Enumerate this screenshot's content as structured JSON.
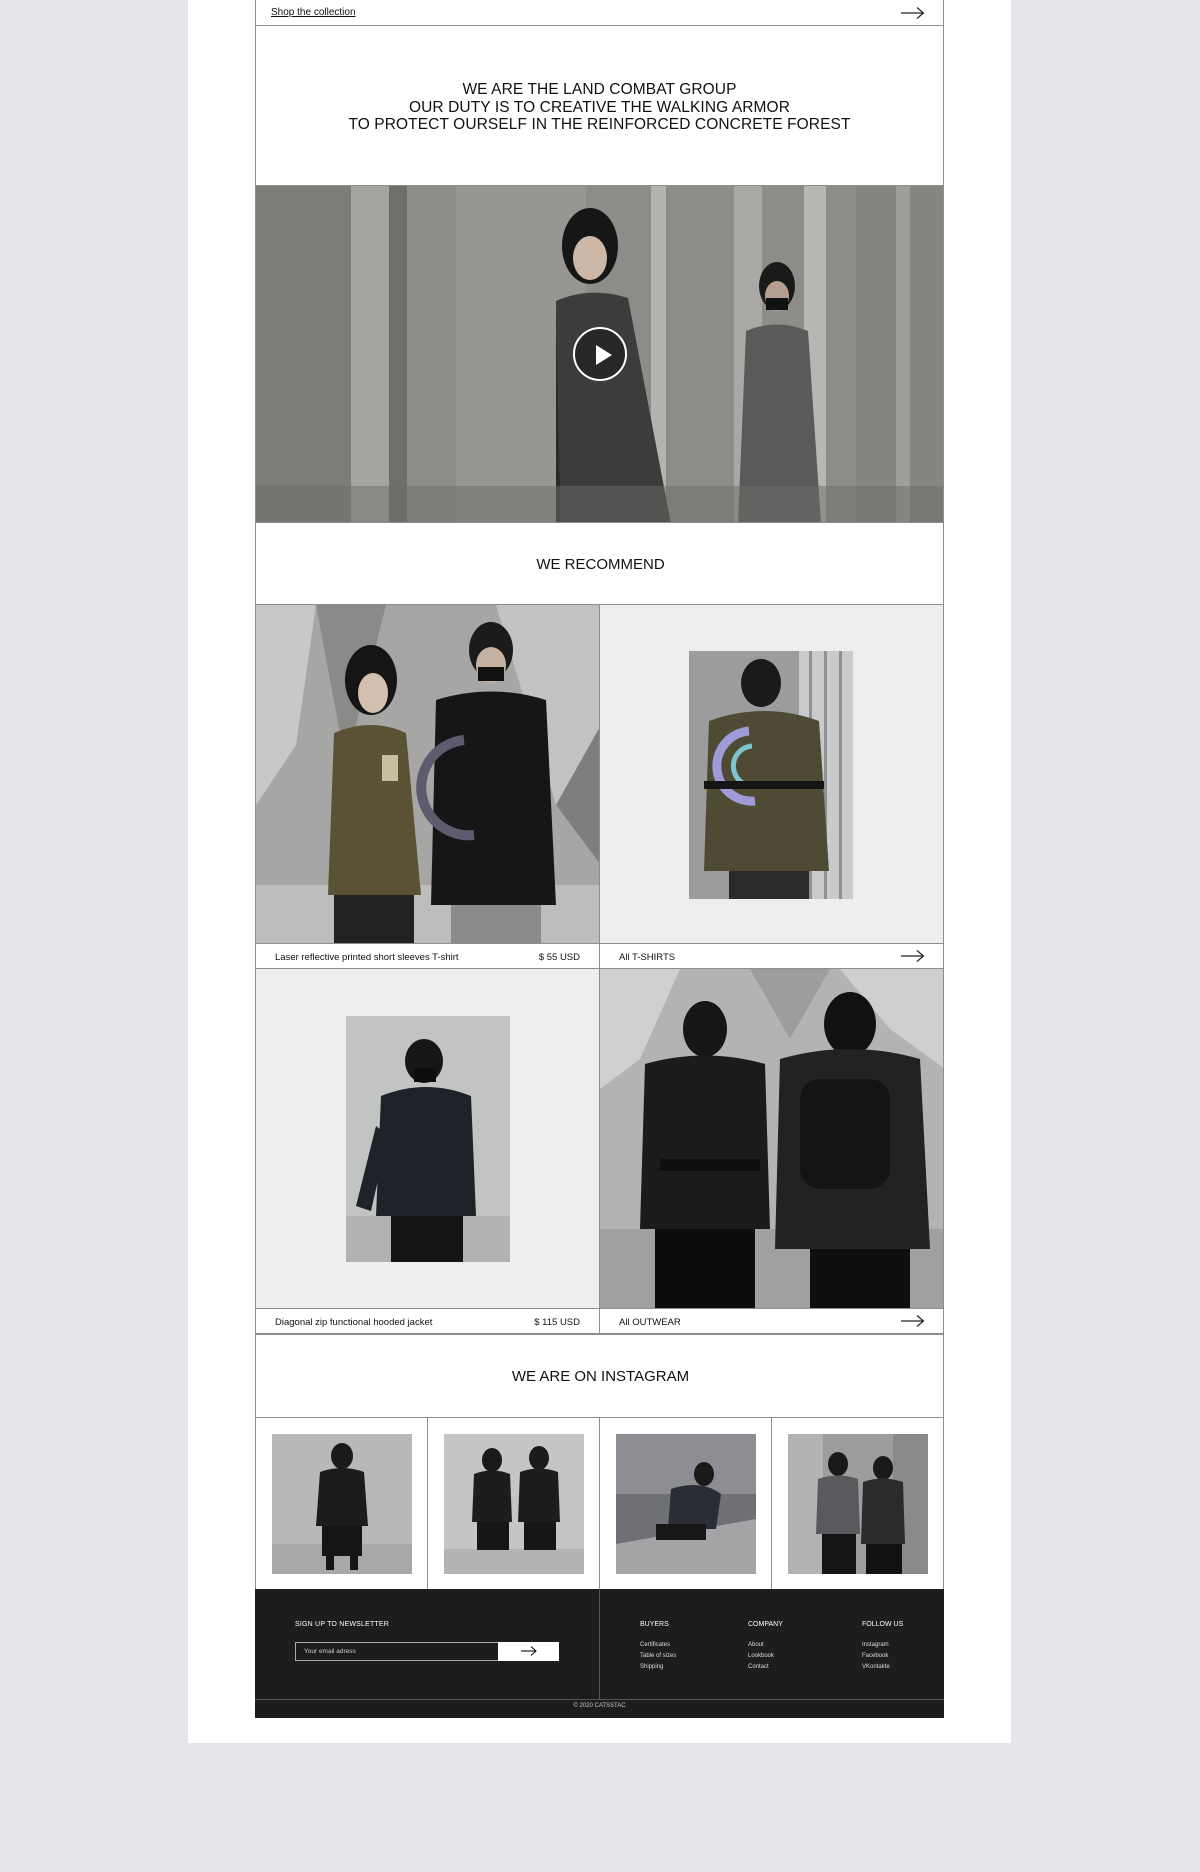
{
  "shop_link": "Shop the collection",
  "manifesto": {
    "line1": "WE ARE THE LAND COMBAT GROUP",
    "line2": "OUR DUTY IS TO CREATIVE THE WALKING ARMOR",
    "line3": "TO PROTECT OURSELF IN THE REINFORCED CONCRETE FOREST"
  },
  "recommend_title": "WE RECOMMEND",
  "products": [
    {
      "name": "Laser reflective printed short sleeves T-shirt",
      "price": "$ 55 USD"
    },
    {
      "name": "Diagonal zip functional hooded jacket",
      "price": "$ 115 USD"
    }
  ],
  "categories": [
    {
      "label": "All T-SHIRTS"
    },
    {
      "label": "All OUTWEAR"
    }
  ],
  "instagram_title": "WE ARE ON INSTAGRAM",
  "footer": {
    "newsletter_label": "SIGN UP TO NEWSLETTER",
    "email_placeholder": "Your email adress",
    "columns": [
      {
        "title": "BUYERS",
        "links": [
          "Certificates",
          "Table of sizes",
          "Shipping"
        ]
      },
      {
        "title": "COMPANY",
        "links": [
          "About",
          "Lookbook",
          "Contact"
        ]
      },
      {
        "title": "FOLLOW US",
        "links": [
          "Instagram",
          "Facebook",
          "VKontakte"
        ]
      }
    ],
    "copyright": "© 2020 CATSSTAC"
  },
  "icons": {
    "arrow": "arrow-right-icon",
    "play": "play-icon"
  },
  "colors": {
    "page_bg": "#e6e6ea",
    "footer_bg": "#1f1c1c",
    "panel_bg": "#eeeef1"
  }
}
